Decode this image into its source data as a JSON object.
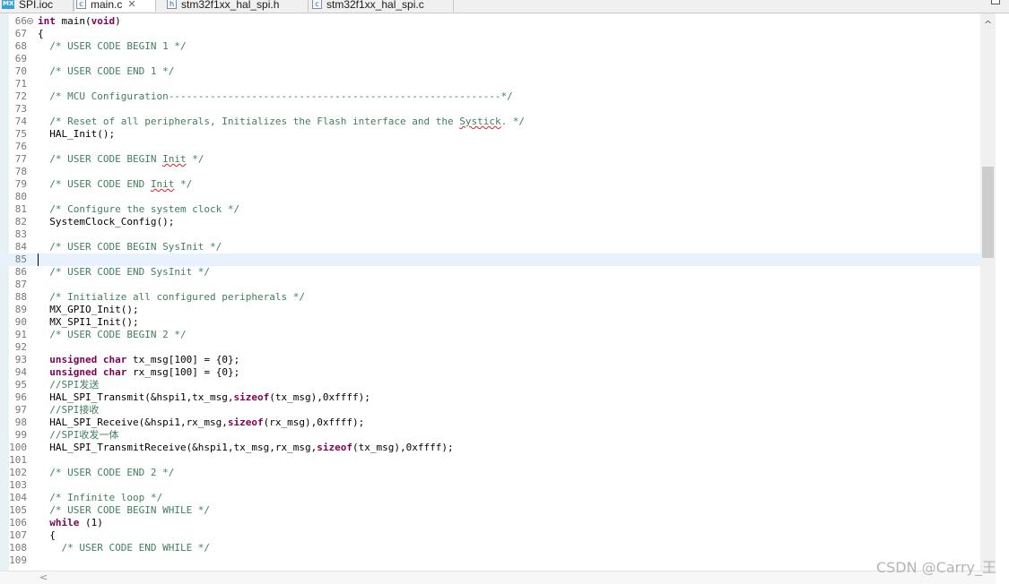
{
  "tabs": [
    {
      "label": "SPI.ioc",
      "icon": "mx-file-icon",
      "icon_text": "MX",
      "active": false
    },
    {
      "label": "main.c",
      "icon": "c-source-file-icon",
      "icon_text": "c",
      "active": true,
      "close": "✕"
    },
    {
      "label": "stm32f1xx_hal_spi.h",
      "icon": "h-header-file-icon",
      "icon_text": "h",
      "active": false
    },
    {
      "label": "stm32f1xx_hal_spi.c",
      "icon": "c-source-file-icon",
      "icon_text": "c",
      "active": false
    }
  ],
  "editor": {
    "current_line": 85,
    "lines": [
      {
        "n": "66",
        "fold": true,
        "segs": [
          {
            "t": "int",
            "c": "kw"
          },
          {
            "t": " main("
          },
          {
            "t": "void",
            "c": "kw"
          },
          {
            "t": ")"
          }
        ]
      },
      {
        "n": "67",
        "segs": [
          {
            "t": "{"
          }
        ]
      },
      {
        "n": "68",
        "segs": [
          {
            "t": "  /* USER CODE BEGIN 1 */",
            "c": "cmt"
          }
        ]
      },
      {
        "n": "69",
        "segs": []
      },
      {
        "n": "70",
        "segs": [
          {
            "t": "  /* USER CODE END 1 */",
            "c": "cmt"
          }
        ]
      },
      {
        "n": "71",
        "segs": []
      },
      {
        "n": "72",
        "segs": [
          {
            "t": "  /* MCU Configuration--------------------------------------------------------*/",
            "c": "cmt"
          }
        ]
      },
      {
        "n": "73",
        "segs": []
      },
      {
        "n": "74",
        "segs": [
          {
            "t": "  /* Reset of all peripherals, Initializes the Flash interface and the ",
            "c": "cmt"
          },
          {
            "t": "Systick",
            "c": "cmt squig"
          },
          {
            "t": ". */",
            "c": "cmt"
          }
        ]
      },
      {
        "n": "75",
        "segs": [
          {
            "t": "  HAL_Init();"
          }
        ]
      },
      {
        "n": "76",
        "segs": []
      },
      {
        "n": "77",
        "segs": [
          {
            "t": "  /* USER CODE BEGIN ",
            "c": "cmt"
          },
          {
            "t": "Init",
            "c": "cmt squig"
          },
          {
            "t": " */",
            "c": "cmt"
          }
        ]
      },
      {
        "n": "78",
        "segs": []
      },
      {
        "n": "79",
        "segs": [
          {
            "t": "  /* USER CODE END ",
            "c": "cmt"
          },
          {
            "t": "Init",
            "c": "cmt squig"
          },
          {
            "t": " */",
            "c": "cmt"
          }
        ]
      },
      {
        "n": "80",
        "segs": []
      },
      {
        "n": "81",
        "segs": [
          {
            "t": "  /* Configure the system clock */",
            "c": "cmt"
          }
        ]
      },
      {
        "n": "82",
        "segs": [
          {
            "t": "  SystemClock_Config();"
          }
        ]
      },
      {
        "n": "83",
        "segs": []
      },
      {
        "n": "84",
        "segs": [
          {
            "t": "  /* USER CODE BEGIN SysInit */",
            "c": "cmt"
          }
        ]
      },
      {
        "n": "85",
        "segs": []
      },
      {
        "n": "86",
        "segs": [
          {
            "t": "  /* USER CODE END SysInit */",
            "c": "cmt"
          }
        ]
      },
      {
        "n": "87",
        "segs": []
      },
      {
        "n": "88",
        "segs": [
          {
            "t": "  /* Initialize all configured peripherals */",
            "c": "cmt"
          }
        ]
      },
      {
        "n": "89",
        "segs": [
          {
            "t": "  MX_GPIO_Init();"
          }
        ]
      },
      {
        "n": "90",
        "segs": [
          {
            "t": "  MX_SPI1_Init();"
          }
        ]
      },
      {
        "n": "91",
        "segs": [
          {
            "t": "  /* USER CODE BEGIN 2 */",
            "c": "cmt"
          }
        ]
      },
      {
        "n": "92",
        "segs": []
      },
      {
        "n": "93",
        "segs": [
          {
            "t": "  "
          },
          {
            "t": "unsigned",
            "c": "kw"
          },
          {
            "t": " "
          },
          {
            "t": "char",
            "c": "kw"
          },
          {
            "t": " tx_msg[100] = {0};"
          }
        ]
      },
      {
        "n": "94",
        "segs": [
          {
            "t": "  "
          },
          {
            "t": "unsigned",
            "c": "kw"
          },
          {
            "t": " "
          },
          {
            "t": "char",
            "c": "kw"
          },
          {
            "t": " rx_msg[100] = {0};"
          }
        ]
      },
      {
        "n": "95",
        "segs": [
          {
            "t": "  //SPI发送",
            "c": "cmt"
          }
        ]
      },
      {
        "n": "96",
        "segs": [
          {
            "t": "  HAL_SPI_Transmit(&hspi1,tx_msg,"
          },
          {
            "t": "sizeof",
            "c": "kw"
          },
          {
            "t": "(tx_msg),0xffff);"
          }
        ]
      },
      {
        "n": "97",
        "segs": [
          {
            "t": "  //SPI接收",
            "c": "cmt"
          }
        ]
      },
      {
        "n": "98",
        "segs": [
          {
            "t": "  HAL_SPI_Receive(&hspi1,rx_msg,"
          },
          {
            "t": "sizeof",
            "c": "kw"
          },
          {
            "t": "(rx_msg),0xffff);"
          }
        ]
      },
      {
        "n": "99",
        "segs": [
          {
            "t": "  //SPI收发一体",
            "c": "cmt"
          }
        ]
      },
      {
        "n": "100",
        "segs": [
          {
            "t": "  HAL_SPI_TransmitReceive(&hspi1,tx_msg,rx_msg,"
          },
          {
            "t": "sizeof",
            "c": "kw"
          },
          {
            "t": "(tx_msg),0xffff);"
          }
        ]
      },
      {
        "n": "101",
        "segs": []
      },
      {
        "n": "102",
        "segs": [
          {
            "t": "  /* USER CODE END 2 */",
            "c": "cmt"
          }
        ]
      },
      {
        "n": "103",
        "segs": []
      },
      {
        "n": "104",
        "segs": [
          {
            "t": "  /* Infinite loop */",
            "c": "cmt"
          }
        ]
      },
      {
        "n": "105",
        "segs": [
          {
            "t": "  /* USER CODE BEGIN WHILE */",
            "c": "cmt"
          }
        ]
      },
      {
        "n": "106",
        "segs": [
          {
            "t": "  "
          },
          {
            "t": "while",
            "c": "kw"
          },
          {
            "t": " (1)"
          }
        ]
      },
      {
        "n": "107",
        "segs": [
          {
            "t": "  {"
          }
        ]
      },
      {
        "n": "108",
        "segs": [
          {
            "t": "    /* USER CODE END WHILE */",
            "c": "cmt"
          }
        ]
      },
      {
        "n": "109",
        "segs": []
      }
    ]
  },
  "colors": {
    "keyword": "#7f0055",
    "comment": "#3f7f5f",
    "current_line": "#e8f2fe",
    "ruler": "#e8f2f5"
  },
  "scroll": {
    "up_arrow": "^",
    "left_arrow": "<"
  },
  "watermark": "CSDN @Carry_王"
}
